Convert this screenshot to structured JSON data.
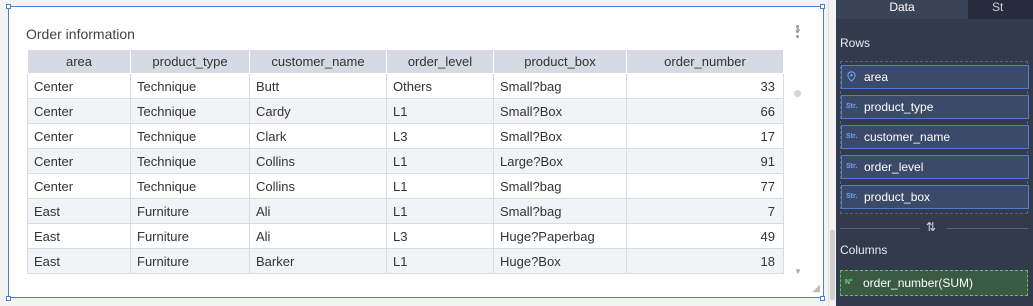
{
  "card": {
    "title": "Order information"
  },
  "table": {
    "columns": [
      "area",
      "product_type",
      "customer_name",
      "order_level",
      "product_box",
      "order_number"
    ],
    "rows": [
      [
        "Center",
        "Technique",
        "Butt",
        "Others",
        "Small?bag",
        "33"
      ],
      [
        "Center",
        "Technique",
        "Cardy",
        "L1",
        "Small?Box",
        "66"
      ],
      [
        "Center",
        "Technique",
        "Clark",
        "L3",
        "Small?Box",
        "17"
      ],
      [
        "Center",
        "Technique",
        "Collins",
        "L1",
        "Large?Box",
        "91"
      ],
      [
        "Center",
        "Technique",
        "Collins",
        "L1",
        "Small?bag",
        "77"
      ],
      [
        "East",
        "Furniture",
        "Ali",
        "L1",
        "Small?bag",
        "7"
      ],
      [
        "East",
        "Furniture",
        "Ali",
        "L3",
        "Huge?Paperbag",
        "49"
      ],
      [
        "East",
        "Furniture",
        "Barker",
        "L1",
        "Huge?Box",
        "18"
      ]
    ]
  },
  "panel": {
    "tabs": [
      "Data",
      "St"
    ],
    "rows_label": "Rows",
    "row_fields": [
      {
        "icon": "location-pin-icon",
        "badge": "",
        "label": "area"
      },
      {
        "icon": "string-type-icon",
        "badge": "Str.",
        "label": "product_type"
      },
      {
        "icon": "string-type-icon",
        "badge": "Str.",
        "label": "customer_name"
      },
      {
        "icon": "string-type-icon",
        "badge": "Str.",
        "label": "order_level"
      },
      {
        "icon": "string-type-icon",
        "badge": "Str.",
        "label": "product_box"
      }
    ],
    "swap_symbol": "⇅",
    "columns_label": "Columns",
    "column_field": {
      "icon": "number-type-icon",
      "badge": "N°",
      "label": "order_number(SUM)"
    }
  },
  "colors": {
    "accent": "#4a7fd4",
    "panel_bg": "#333a4b",
    "measure_green": "#5fbf64"
  }
}
